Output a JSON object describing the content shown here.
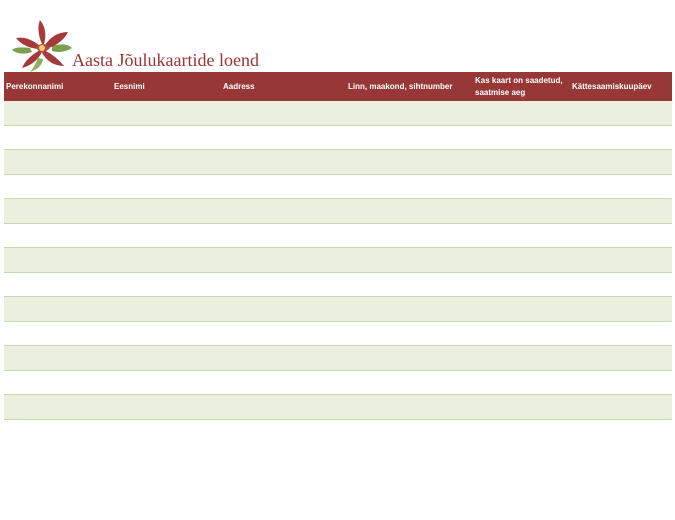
{
  "document": {
    "title": "Aasta Jõulukaartide loend"
  },
  "logo": {
    "icon": "poinsettia-icon",
    "petal_color": "#a53a3a",
    "leaf_color": "#7aa04e",
    "center_color": "#e9d36a"
  },
  "table": {
    "headers": [
      "Perekonnanimi",
      "Eesnimi",
      "Aadress",
      "Linn, maakond, sihtnumber",
      "Kas kaart on saadetud, saatmise aeg",
      "Kättesaamiskuupäev"
    ],
    "header_bg": "#983836",
    "band_color": "#ebf0de",
    "rule_color": "#c6d8ae",
    "rows": [
      [
        "",
        "",
        "",
        "",
        "",
        ""
      ],
      [
        "",
        "",
        "",
        "",
        "",
        ""
      ],
      [
        "",
        "",
        "",
        "",
        "",
        ""
      ],
      [
        "",
        "",
        "",
        "",
        "",
        ""
      ],
      [
        "",
        "",
        "",
        "",
        "",
        ""
      ],
      [
        "",
        "",
        "",
        "",
        "",
        ""
      ],
      [
        "",
        "",
        "",
        "",
        "",
        ""
      ],
      [
        "",
        "",
        "",
        "",
        "",
        ""
      ],
      [
        "",
        "",
        "",
        "",
        "",
        ""
      ],
      [
        "",
        "",
        "",
        "",
        "",
        ""
      ],
      [
        "",
        "",
        "",
        "",
        "",
        ""
      ],
      [
        "",
        "",
        "",
        "",
        "",
        ""
      ],
      [
        "",
        "",
        "",
        "",
        "",
        ""
      ]
    ]
  }
}
